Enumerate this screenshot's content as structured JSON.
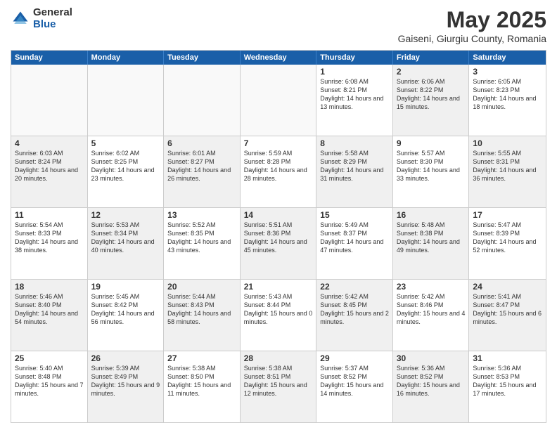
{
  "header": {
    "logo_general": "General",
    "logo_blue": "Blue",
    "title": "May 2025",
    "subtitle": "Gaiseni, Giurgiu County, Romania"
  },
  "calendar": {
    "days_of_week": [
      "Sunday",
      "Monday",
      "Tuesday",
      "Wednesday",
      "Thursday",
      "Friday",
      "Saturday"
    ],
    "weeks": [
      [
        {
          "day": "",
          "info": "",
          "empty": true
        },
        {
          "day": "",
          "info": "",
          "empty": true
        },
        {
          "day": "",
          "info": "",
          "empty": true
        },
        {
          "day": "",
          "info": "",
          "empty": true
        },
        {
          "day": "1",
          "info": "Sunrise: 6:08 AM\nSunset: 8:21 PM\nDaylight: 14 hours\nand 13 minutes.",
          "shaded": false
        },
        {
          "day": "2",
          "info": "Sunrise: 6:06 AM\nSunset: 8:22 PM\nDaylight: 14 hours\nand 15 minutes.",
          "shaded": true
        },
        {
          "day": "3",
          "info": "Sunrise: 6:05 AM\nSunset: 8:23 PM\nDaylight: 14 hours\nand 18 minutes.",
          "shaded": false
        }
      ],
      [
        {
          "day": "4",
          "info": "Sunrise: 6:03 AM\nSunset: 8:24 PM\nDaylight: 14 hours\nand 20 minutes.",
          "shaded": true
        },
        {
          "day": "5",
          "info": "Sunrise: 6:02 AM\nSunset: 8:25 PM\nDaylight: 14 hours\nand 23 minutes.",
          "shaded": false
        },
        {
          "day": "6",
          "info": "Sunrise: 6:01 AM\nSunset: 8:27 PM\nDaylight: 14 hours\nand 26 minutes.",
          "shaded": true
        },
        {
          "day": "7",
          "info": "Sunrise: 5:59 AM\nSunset: 8:28 PM\nDaylight: 14 hours\nand 28 minutes.",
          "shaded": false
        },
        {
          "day": "8",
          "info": "Sunrise: 5:58 AM\nSunset: 8:29 PM\nDaylight: 14 hours\nand 31 minutes.",
          "shaded": true
        },
        {
          "day": "9",
          "info": "Sunrise: 5:57 AM\nSunset: 8:30 PM\nDaylight: 14 hours\nand 33 minutes.",
          "shaded": false
        },
        {
          "day": "10",
          "info": "Sunrise: 5:55 AM\nSunset: 8:31 PM\nDaylight: 14 hours\nand 36 minutes.",
          "shaded": true
        }
      ],
      [
        {
          "day": "11",
          "info": "Sunrise: 5:54 AM\nSunset: 8:33 PM\nDaylight: 14 hours\nand 38 minutes.",
          "shaded": false
        },
        {
          "day": "12",
          "info": "Sunrise: 5:53 AM\nSunset: 8:34 PM\nDaylight: 14 hours\nand 40 minutes.",
          "shaded": true
        },
        {
          "day": "13",
          "info": "Sunrise: 5:52 AM\nSunset: 8:35 PM\nDaylight: 14 hours\nand 43 minutes.",
          "shaded": false
        },
        {
          "day": "14",
          "info": "Sunrise: 5:51 AM\nSunset: 8:36 PM\nDaylight: 14 hours\nand 45 minutes.",
          "shaded": true
        },
        {
          "day": "15",
          "info": "Sunrise: 5:49 AM\nSunset: 8:37 PM\nDaylight: 14 hours\nand 47 minutes.",
          "shaded": false
        },
        {
          "day": "16",
          "info": "Sunrise: 5:48 AM\nSunset: 8:38 PM\nDaylight: 14 hours\nand 49 minutes.",
          "shaded": true
        },
        {
          "day": "17",
          "info": "Sunrise: 5:47 AM\nSunset: 8:39 PM\nDaylight: 14 hours\nand 52 minutes.",
          "shaded": false
        }
      ],
      [
        {
          "day": "18",
          "info": "Sunrise: 5:46 AM\nSunset: 8:40 PM\nDaylight: 14 hours\nand 54 minutes.",
          "shaded": true
        },
        {
          "day": "19",
          "info": "Sunrise: 5:45 AM\nSunset: 8:42 PM\nDaylight: 14 hours\nand 56 minutes.",
          "shaded": false
        },
        {
          "day": "20",
          "info": "Sunrise: 5:44 AM\nSunset: 8:43 PM\nDaylight: 14 hours\nand 58 minutes.",
          "shaded": true
        },
        {
          "day": "21",
          "info": "Sunrise: 5:43 AM\nSunset: 8:44 PM\nDaylight: 15 hours\nand 0 minutes.",
          "shaded": false
        },
        {
          "day": "22",
          "info": "Sunrise: 5:42 AM\nSunset: 8:45 PM\nDaylight: 15 hours\nand 2 minutes.",
          "shaded": true
        },
        {
          "day": "23",
          "info": "Sunrise: 5:42 AM\nSunset: 8:46 PM\nDaylight: 15 hours\nand 4 minutes.",
          "shaded": false
        },
        {
          "day": "24",
          "info": "Sunrise: 5:41 AM\nSunset: 8:47 PM\nDaylight: 15 hours\nand 6 minutes.",
          "shaded": true
        }
      ],
      [
        {
          "day": "25",
          "info": "Sunrise: 5:40 AM\nSunset: 8:48 PM\nDaylight: 15 hours\nand 7 minutes.",
          "shaded": false
        },
        {
          "day": "26",
          "info": "Sunrise: 5:39 AM\nSunset: 8:49 PM\nDaylight: 15 hours\nand 9 minutes.",
          "shaded": true
        },
        {
          "day": "27",
          "info": "Sunrise: 5:38 AM\nSunset: 8:50 PM\nDaylight: 15 hours\nand 11 minutes.",
          "shaded": false
        },
        {
          "day": "28",
          "info": "Sunrise: 5:38 AM\nSunset: 8:51 PM\nDaylight: 15 hours\nand 12 minutes.",
          "shaded": true
        },
        {
          "day": "29",
          "info": "Sunrise: 5:37 AM\nSunset: 8:52 PM\nDaylight: 15 hours\nand 14 minutes.",
          "shaded": false
        },
        {
          "day": "30",
          "info": "Sunrise: 5:36 AM\nSunset: 8:52 PM\nDaylight: 15 hours\nand 16 minutes.",
          "shaded": true
        },
        {
          "day": "31",
          "info": "Sunrise: 5:36 AM\nSunset: 8:53 PM\nDaylight: 15 hours\nand 17 minutes.",
          "shaded": false
        }
      ]
    ]
  }
}
